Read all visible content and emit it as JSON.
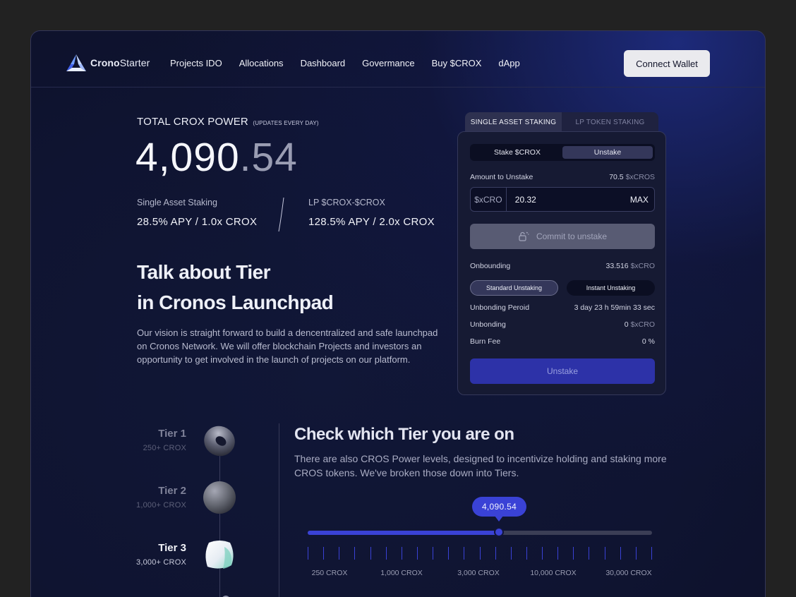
{
  "header": {
    "logo_bold": "Crono",
    "logo_light": "Starter",
    "nav": [
      "Projects IDO",
      "Allocations",
      "Dashboard",
      "Govermance",
      "Buy $CROX",
      "dApp"
    ],
    "connect_label": "Connect Wallet"
  },
  "hero": {
    "power_title": "TOTAL CROX POWER",
    "power_note": "(UPDATES EVERY DAY)",
    "power_int": "4,090",
    "power_dec": ".54",
    "stats": [
      {
        "label": "Single Asset Staking",
        "value": "28.5% APY / 1.0x CROX"
      },
      {
        "label": "LP $CROX-$CROX",
        "value": "128.5% APY / 2.0x CROX"
      }
    ],
    "talk_line1": "Talk about Tier",
    "talk_line2": "in Cronos Launchpad",
    "description": "Our vision is straight forward to build a dencentralized and safe launchpad on Cronos Network. We will offer blockchain Projects and investors an opportunity to get involved in the launch of projects on our platform."
  },
  "staking": {
    "tabs": [
      "SINGLE ASSET STAKING",
      "LP TOKEN STAKING"
    ],
    "segments": [
      "Stake $CROX",
      "Unstake"
    ],
    "amount_label": "Amount to Unstake",
    "amount_balance_value": "70.5",
    "amount_balance_unit": "$xCROS",
    "token_label": "$xCRO",
    "amount_value": "20.32",
    "max_label": "MAX",
    "commit_label": "Commit to unstake",
    "onbounding_label": "Onbounding",
    "onbounding_value": "33.516",
    "onbounding_unit": "$xCRO",
    "modes": [
      "Standard Unstaking",
      "Instant Unstaking"
    ],
    "period_label": "Unbonding Peroid",
    "period_value": "3 day 23 h 59min 33 sec",
    "unbonding_label": "Unbonding",
    "unbonding_value": "0",
    "unbonding_unit": "$xCRO",
    "fee_label": "Burn Fee",
    "fee_value": "0 %",
    "unstake_label": "Unstake"
  },
  "tiers": [
    {
      "name": "Tier 1",
      "req": "250+ CROX"
    },
    {
      "name": "Tier 2",
      "req": "1,000+ CROX"
    },
    {
      "name": "Tier 3",
      "req": "3,000+  CROX"
    }
  ],
  "check": {
    "title": "Check which Tier you are on",
    "description": "There are also CROS Power levels, designed to incentivize holding and staking more CROS tokens. We've broken those down into Tiers.",
    "bubble": "4,090.54",
    "slider_fraction": 0.555,
    "tick_labels": [
      "250 CROX",
      "1,000 CROX",
      "3,000 CROX",
      "10,000 CROX",
      "30,000 CROX"
    ]
  },
  "colors": {
    "accent": "#3a42d6",
    "background": "#0f1431"
  }
}
